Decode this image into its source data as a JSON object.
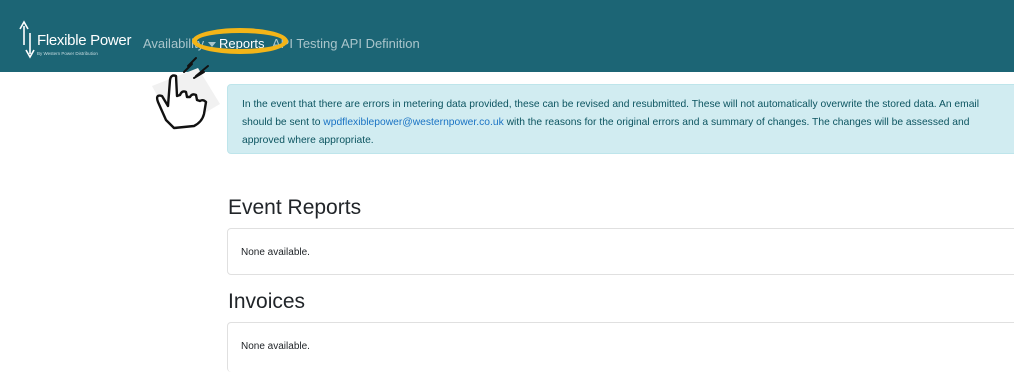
{
  "navbar": {
    "brand": "Flexible Power",
    "brand_tagline": "By Western Power Distribution",
    "links": [
      {
        "label": "Availability",
        "has_dropdown": true
      },
      {
        "label": "Reports",
        "active": true
      },
      {
        "label": "API Testing"
      },
      {
        "label": "API Definition"
      }
    ],
    "colors": {
      "background": "#1c6575",
      "highlight_ring": "#f3b518"
    }
  },
  "overlay": {
    "icon": "pointing-hand-icon"
  },
  "notice": {
    "text_before": "In the event that there are errors in metering data provided, these can be revised and resubmitted. These will not automatically overwrite the stored data. An email should be sent to ",
    "email": "wpdflexiblepower@westernpower.co.uk",
    "text_after": " with the reasons for the original errors and a summary of changes. The changes will be assessed and approved where appropriate."
  },
  "event_reports": {
    "heading": "Event Reports",
    "empty_text": "None available."
  },
  "invoices": {
    "heading": "Invoices",
    "empty_text": "None available."
  }
}
